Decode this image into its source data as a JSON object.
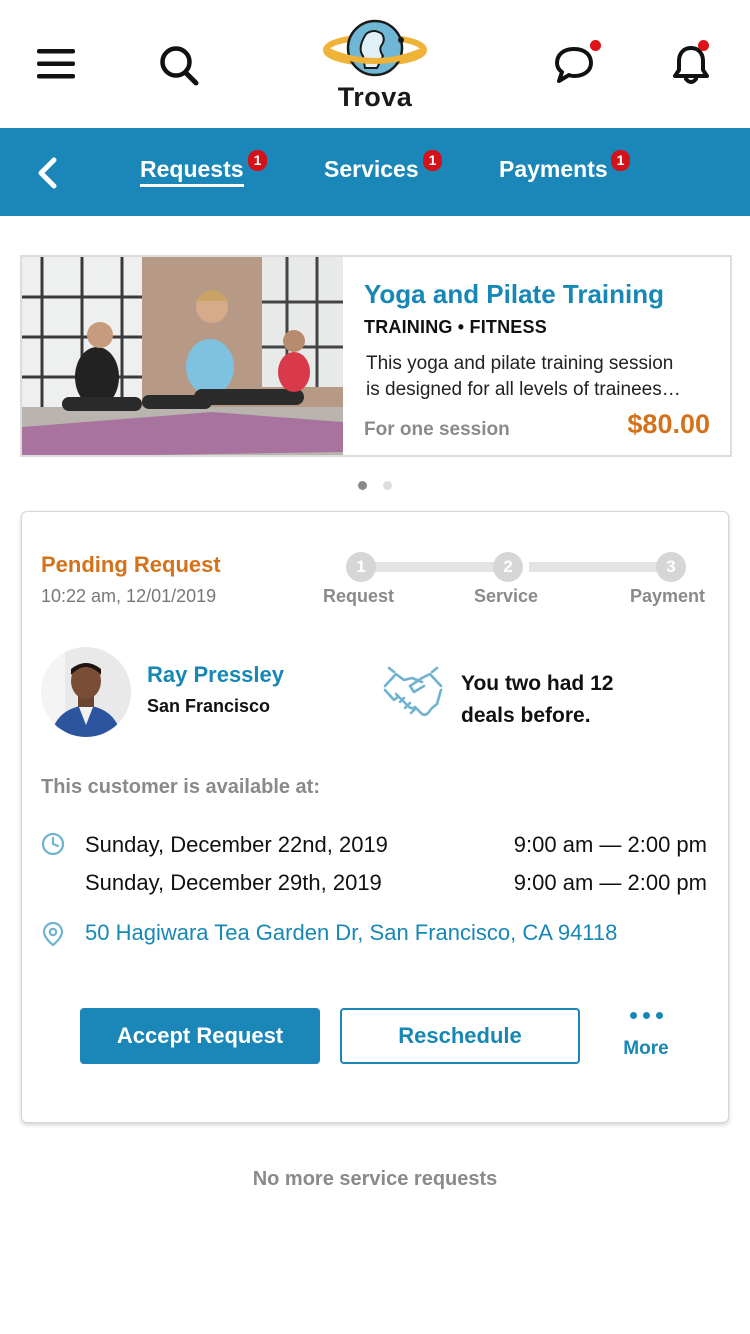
{
  "app": {
    "name": "Trova"
  },
  "colors": {
    "brand": "#1a87b8",
    "accent": "#d4721c",
    "badge": "#d3121c",
    "link": "#1787b5"
  },
  "header": {
    "icons": [
      "menu-icon",
      "search-icon",
      "chat-icon",
      "bell-icon"
    ]
  },
  "tabs": [
    {
      "label": "Requests",
      "badge": "1",
      "active": true
    },
    {
      "label": "Services",
      "badge": "1",
      "active": false
    },
    {
      "label": "Payments",
      "badge": "1",
      "active": false
    }
  ],
  "service": {
    "title": "Yoga and Pilate Training",
    "category": "TRAINING • FITNESS",
    "description_lines": [
      "This yoga and pilate training session",
      "is designed for all levels of  trainees…"
    ],
    "footer": "For one session",
    "price": "$80.00"
  },
  "carousel": {
    "count": 2,
    "active": 1
  },
  "request": {
    "status": "Pending Request",
    "timestamp": "10:22 am, 12/01/2019",
    "steps": [
      {
        "num": "1",
        "label": "Request"
      },
      {
        "num": "2",
        "label": "Service"
      },
      {
        "num": "3",
        "label": "Payment"
      }
    ],
    "customer": {
      "name": "Ray Pressley",
      "city": "San Francisco"
    },
    "deals_text": "You two had 12 deals before.",
    "available_label": "This customer is available at:",
    "slots": [
      {
        "date": "Sunday, December 22nd, 2019",
        "time": "9:00 am — 2:00 pm"
      },
      {
        "date": "Sunday, December 29th, 2019",
        "time": "9:00 am — 2:00 pm"
      }
    ],
    "address": "50 Hagiwara Tea Garden Dr, San Francisco, CA 94118",
    "actions": {
      "accept": "Accept Request",
      "reschedule": "Reschedule",
      "more": "More"
    }
  },
  "footer_text": "No more service requests"
}
